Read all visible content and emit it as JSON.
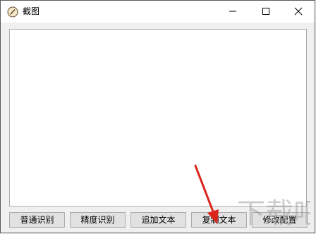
{
  "window": {
    "title": "截图",
    "icon": "pencil-circle-icon"
  },
  "controls": {
    "minimize": "minimize-icon",
    "maximize": "maximize-icon",
    "close": "close-icon"
  },
  "text_area": {
    "value": ""
  },
  "buttons": [
    {
      "label": "普通识别"
    },
    {
      "label": "精度识别"
    },
    {
      "label": "追加文本"
    },
    {
      "label": "复制文本"
    },
    {
      "label": "修改配置"
    }
  ],
  "overlay": {
    "arrow_color": "#d9261c",
    "watermark": "下载吧"
  }
}
